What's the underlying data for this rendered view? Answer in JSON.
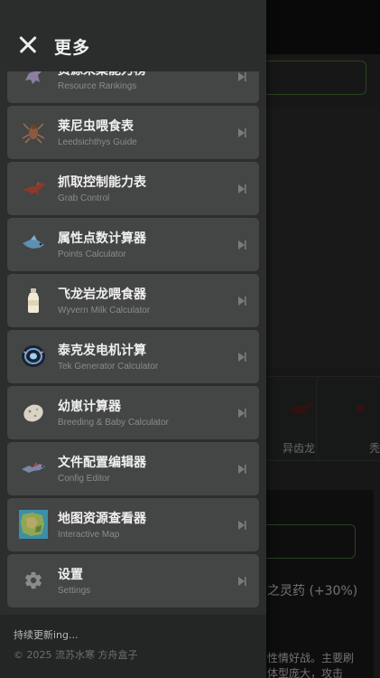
{
  "header": {
    "title": "更多",
    "close_icon": "close-icon"
  },
  "menu": {
    "items": [
      {
        "title": "资源采集能力榜",
        "subtitle": "Resource Rankings",
        "icon": "dinosaur-icon",
        "arrow": "chevron-right-icon"
      },
      {
        "title": "莱尼虫喂食表",
        "subtitle": "Leedsichthys Guide",
        "icon": "insect-icon",
        "arrow": "chevron-right-icon"
      },
      {
        "title": "抓取控制能力表",
        "subtitle": "Grab Control",
        "icon": "raptor-icon",
        "arrow": "chevron-right-icon"
      },
      {
        "title": "属性点数计算器",
        "subtitle": "Points Calculator",
        "icon": "blue-creature-icon",
        "arrow": "chevron-right-icon"
      },
      {
        "title": "飞龙岩龙喂食器",
        "subtitle": "Wyvern Milk Calculator",
        "icon": "milk-bottle-icon",
        "arrow": "chevron-right-icon"
      },
      {
        "title": "泰克发电机计算",
        "subtitle": "Tek Generator Calculator",
        "icon": "tek-generator-icon",
        "arrow": "chevron-right-icon"
      },
      {
        "title": "幼崽计算器",
        "subtitle": "Breeding & Baby Calculator",
        "icon": "egg-icon",
        "arrow": "chevron-right-icon"
      },
      {
        "title": "文件配置编辑器",
        "subtitle": "Config Editor",
        "icon": "flying-creature-icon",
        "arrow": "chevron-right-icon"
      },
      {
        "title": "地图资源查看器",
        "subtitle": "Interactive Map",
        "icon": "map-icon",
        "arrow": "chevron-right-icon"
      },
      {
        "title": "设置",
        "subtitle": "Settings",
        "icon": "gear-icon",
        "arrow": "chevron-right-icon"
      }
    ]
  },
  "footer": {
    "status": "持续更新ing...",
    "copyright": "© 2025 流苏水寒 方舟盒子"
  },
  "background": {
    "card_1_label": "异齿龙",
    "card_2_label": "秃",
    "potion_text": "之灵药 (+30%)",
    "desc_line_1": "性情好战。主要刷",
    "desc_line_2": "体型庞大，攻击"
  },
  "colors": {
    "drawer_bg": "#2c2d2d",
    "item_bg": "#444545",
    "accent_green": "#4c7a3a"
  }
}
